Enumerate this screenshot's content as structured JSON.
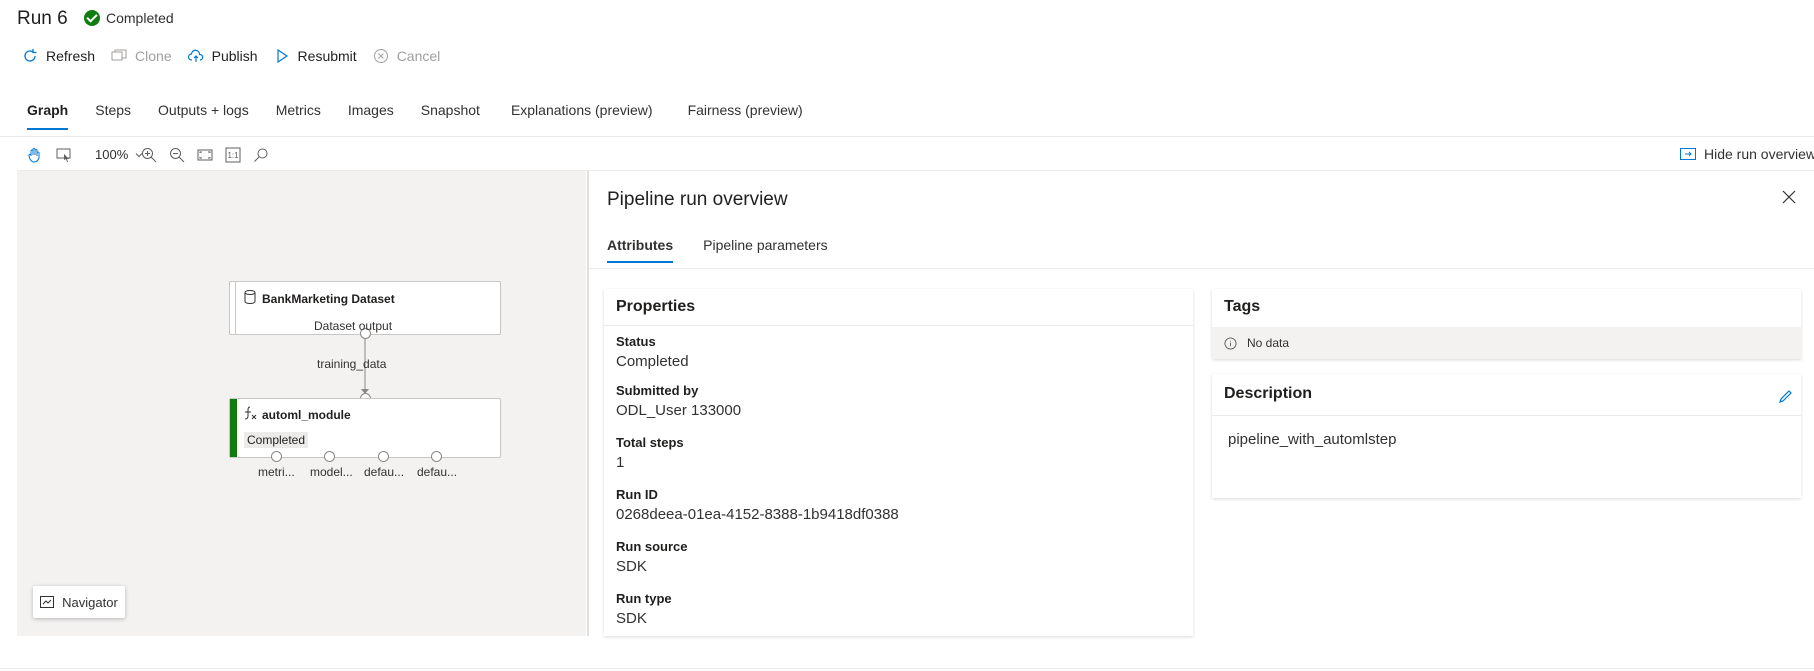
{
  "run": {
    "title": "Run 6",
    "status": "Completed"
  },
  "commands": [
    {
      "label": "Refresh",
      "icon": "refresh-icon",
      "disabled": false
    },
    {
      "label": "Clone",
      "icon": "clone-icon",
      "disabled": true
    },
    {
      "label": "Publish",
      "icon": "cloud-upload-icon",
      "disabled": false
    },
    {
      "label": "Resubmit",
      "icon": "play-icon",
      "disabled": false
    },
    {
      "label": "Cancel",
      "icon": "cancel-icon",
      "disabled": true
    }
  ],
  "tabs": [
    "Graph",
    "Steps",
    "Outputs + logs",
    "Metrics",
    "Images",
    "Snapshot",
    "Explanations (preview)",
    "Fairness (preview)"
  ],
  "toolbar": {
    "zoom": "100%",
    "hide_overview": "Hide run overview",
    "actual_size": "1:1"
  },
  "graph": {
    "dataset_node": {
      "title": "BankMarketing Dataset",
      "output_label": "Dataset output"
    },
    "input_label": "training_data",
    "module_node": {
      "title": "automl_module",
      "status": "Completed"
    },
    "outputs": [
      "metri...",
      "model...",
      "defau...",
      "defau..."
    ],
    "navigator": "Navigator"
  },
  "panel": {
    "title": "Pipeline run overview",
    "tabs": [
      "Attributes",
      "Pipeline parameters"
    ],
    "properties": {
      "heading": "Properties",
      "items": [
        {
          "key": "Status",
          "value": "Completed"
        },
        {
          "key": "Submitted by",
          "value": "ODL_User 133000"
        },
        {
          "key": "Total steps",
          "value": "1"
        },
        {
          "key": "Run ID",
          "value": "0268deea-01ea-4152-8388-1b9418df0388"
        },
        {
          "key": "Run source",
          "value": "SDK"
        },
        {
          "key": "Run type",
          "value": "SDK"
        }
      ]
    },
    "tags": {
      "heading": "Tags",
      "empty": "No data"
    },
    "description": {
      "heading": "Description",
      "text": "pipeline_with_automlstep"
    }
  },
  "colors": {
    "accent": "#0078d4",
    "success": "#107c10"
  }
}
